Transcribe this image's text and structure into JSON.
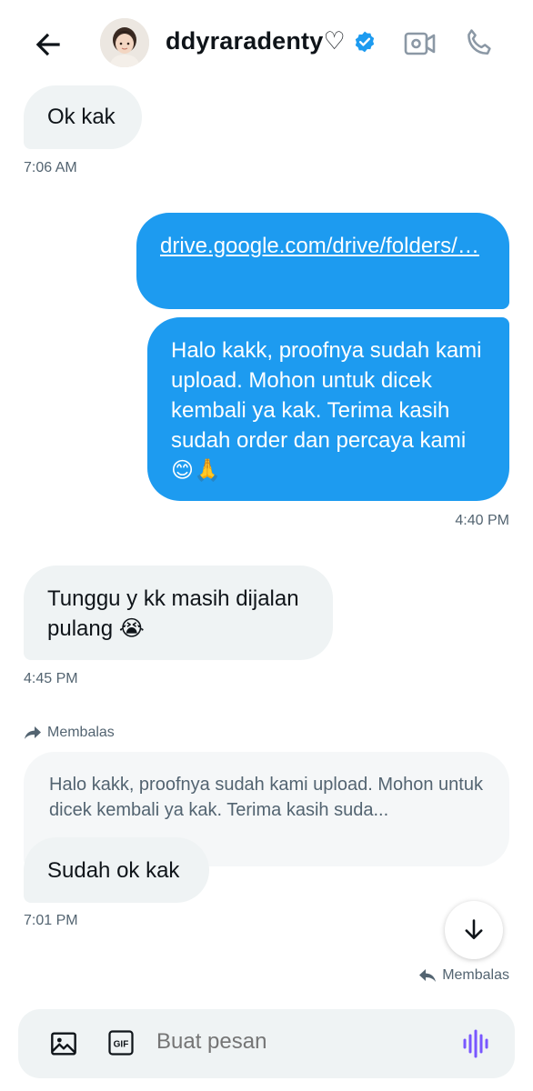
{
  "header": {
    "title": "ddyraradenty♡",
    "icons": [
      "back-arrow-icon",
      "avatar",
      "verified-badge-icon",
      "video-call-icon",
      "phone-call-icon"
    ]
  },
  "messages": [
    {
      "side": "in",
      "text": "Ok kak",
      "time": "7:06 AM"
    },
    {
      "side": "out",
      "text": "drive.google.com/drive/folders/…",
      "link": true
    },
    {
      "side": "out",
      "text": "Halo kakk, proofnya sudah kami upload. Mohon untuk dicek kembali ya kak. Terima kasih sudah order dan percaya kami 😊🙏",
      "time": "4:40 PM"
    },
    {
      "side": "in",
      "text": "Tunggu y kk masih dijalan pulang 😭",
      "time": "4:45 PM"
    },
    {
      "side": "in",
      "reply_label": "Membalas",
      "quoted": "Halo kakk, proofnya sudah kami upload. Mohon untuk dicek kembali ya kak. Terima kasih suda...",
      "text": "Sudah ok kak",
      "time": "7:01 PM"
    }
  ],
  "reply_right_label": "Membalas",
  "composer": {
    "placeholder": "Buat pesan",
    "icons": [
      "image-icon",
      "gif-icon",
      "voice-message-icon"
    ]
  },
  "colors": {
    "accent": "#1d9bf0",
    "incoming_bg": "#eff3f4",
    "voice": "#7856ff"
  }
}
